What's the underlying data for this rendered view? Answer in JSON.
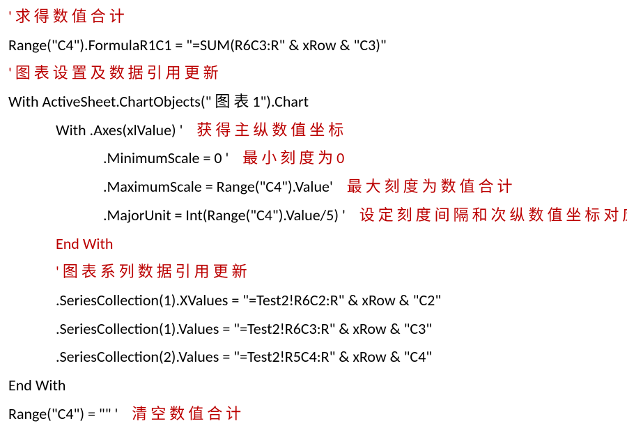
{
  "lines": {
    "l1": "' 求 得 数 值 合 计",
    "l2": "Range(\"C4\").FormulaR1C1 = \"=SUM(R6C3:R\" & xRow & \"C3)\"",
    "l3": "' 图 表 设 置 及 数 据 引 用 更 新",
    "l4": "With ActiveSheet.ChartObjects(\" 图 表 1\").Chart",
    "l5a": "With .Axes(xlValue) '",
    "l5b": "    获 得 主 纵 数 值 坐 标",
    "l6a": ".MinimumScale = 0 '",
    "l6b": "    最 小 刻 度 为 0",
    "l7a": ".MaximumScale = Range(\"C4\").Value'",
    "l7b": "    最 大 刻 度 为 数 值 合 计",
    "l8a": ".MajorUnit = Int(Range(\"C4\").Value/5) '",
    "l8b": "    设 定 刻 度 间 隔 和 次 纵 数 值 坐 标 对 应",
    "l9": "End With",
    "l10": "' 图 表 系 列 数 据 引 用 更 新",
    "l11": ".SeriesCollection(1).XValues = \"=Test2!R6C2:R\" & xRow & \"C2\"",
    "l12": ".SeriesCollection(1).Values = \"=Test2!R6C3:R\" & xRow & \"C3\"",
    "l13": ".SeriesCollection(2).Values = \"=Test2!R5C4:R\" & xRow & \"C4\"",
    "l14": "End With",
    "l15a": "Range(\"C4\") = \"\" '",
    "l15b": "    清 空 数 值 合 计"
  }
}
